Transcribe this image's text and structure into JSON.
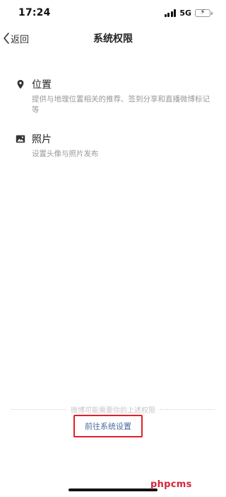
{
  "status_bar": {
    "time": "17:24",
    "network": "5G",
    "battery_color": "#34c759"
  },
  "nav": {
    "back_label": "返回",
    "title": "系统权限"
  },
  "permissions": [
    {
      "icon": "location-pin-icon",
      "title": "位置",
      "description": "提供与地理位置相关的推荐、签到分享和直播微博标记等"
    },
    {
      "icon": "photo-icon",
      "title": "照片",
      "description": "设置头像与照片发布"
    }
  ],
  "footer": {
    "hint": "微博可能需要你的上述权限",
    "button_label": "前往系统设置",
    "highlight_color": "#e0202a"
  },
  "watermark": "phpcms"
}
